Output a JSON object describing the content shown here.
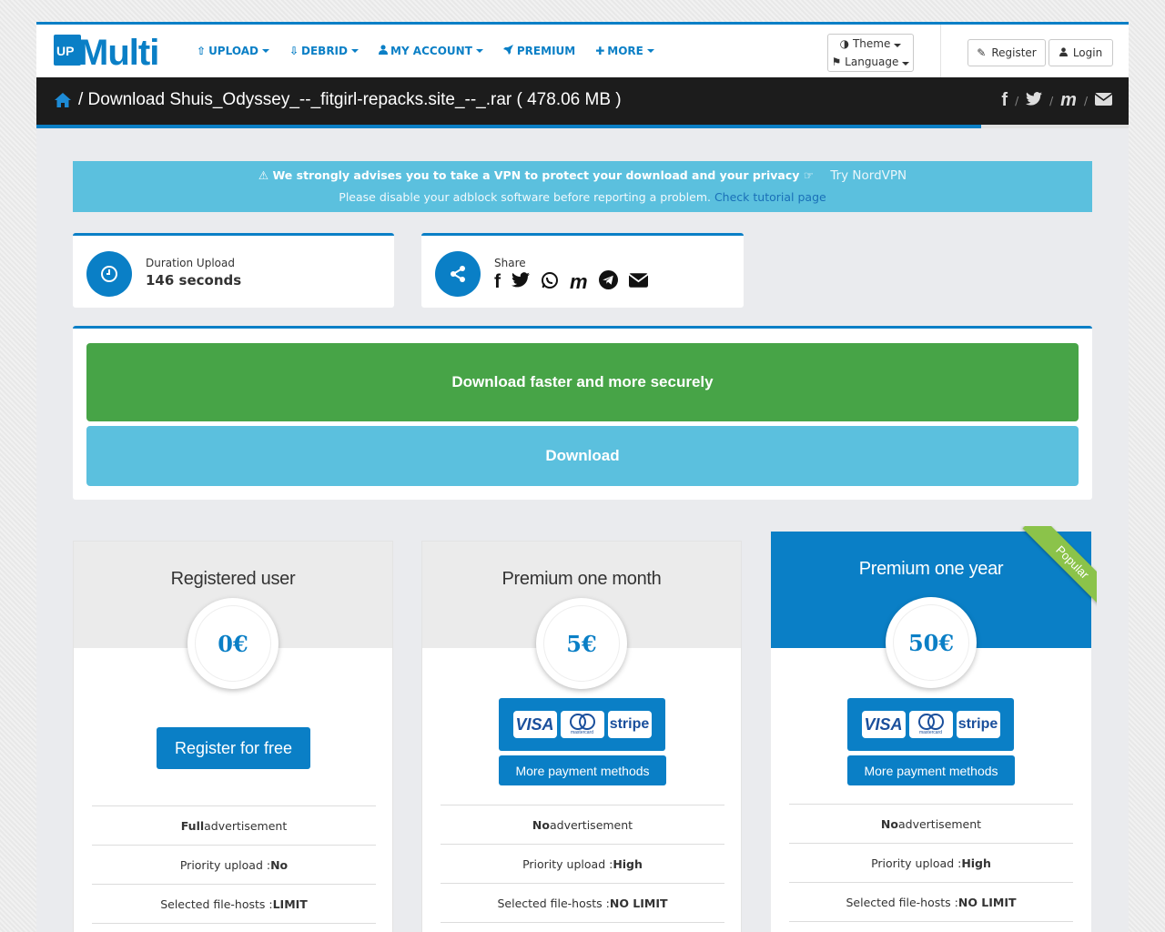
{
  "brand": {
    "logo_small": "UP",
    "logo_main": "Multi"
  },
  "nav": [
    {
      "label": "UPLOAD",
      "icon": "upload-icon"
    },
    {
      "label": "DEBRID",
      "icon": "download-icon"
    },
    {
      "label": "MY ACCOUNT",
      "icon": "user-icon"
    },
    {
      "label": "PREMIUM",
      "icon": "rocket-icon"
    },
    {
      "label": "MORE",
      "icon": "plus-icon"
    }
  ],
  "theme_label": "Theme",
  "language_label": "Language",
  "auth": {
    "register": "Register",
    "login": "Login"
  },
  "page_title": "/ Download Shuis_Odyssey_--_fitgirl-repacks.site_--_.rar ( 478.06 MB )",
  "progress_fraction": 0.865,
  "alert": {
    "line1": "We strongly advises you to take a VPN to protect your download and your privacy",
    "vpn_link": "Try NordVPN",
    "line2": "Please disable your adblock software before reporting a problem.",
    "tutorial_link": "Check tutorial page"
  },
  "duration": {
    "label": "Duration Upload",
    "value": "146 seconds"
  },
  "share": {
    "label": "Share"
  },
  "buttons": {
    "faster": "Download faster and more securely",
    "download": "Download"
  },
  "plans": [
    {
      "name": "Registered user",
      "price": "0€",
      "cta": "Register for free",
      "features": [
        {
          "bold_first": true,
          "a": "Full",
          "b": " advertisement"
        },
        {
          "bold_first": false,
          "a": "Priority upload : ",
          "b": "No"
        },
        {
          "bold_first": false,
          "a": "Selected file-hosts : ",
          "b": "LIMIT"
        }
      ]
    },
    {
      "name": "Premium one month",
      "price": "5€",
      "more_payment": "More payment methods",
      "features": [
        {
          "bold_first": true,
          "a": "No",
          "b": " advertisement"
        },
        {
          "bold_first": false,
          "a": "Priority upload : ",
          "b": "High"
        },
        {
          "bold_first": false,
          "a": "Selected file-hosts : ",
          "b": "NO LIMIT"
        }
      ]
    },
    {
      "name": "Premium one year",
      "price": "50€",
      "more_payment": "More payment methods",
      "ribbon": "Popular",
      "features": [
        {
          "bold_first": true,
          "a": "No",
          "b": " advertisement"
        },
        {
          "bold_first": false,
          "a": "Priority upload : ",
          "b": "High"
        },
        {
          "bold_first": false,
          "a": "Selected file-hosts : ",
          "b": "NO LIMIT"
        }
      ]
    }
  ],
  "payment_logos": {
    "visa": "VISA",
    "mastercard": "mastercard",
    "stripe": "stripe"
  },
  "colors": {
    "primary": "#0a7fc6",
    "green": "#47a447",
    "info": "#5bc0de",
    "dark": "#1c1c1c"
  }
}
